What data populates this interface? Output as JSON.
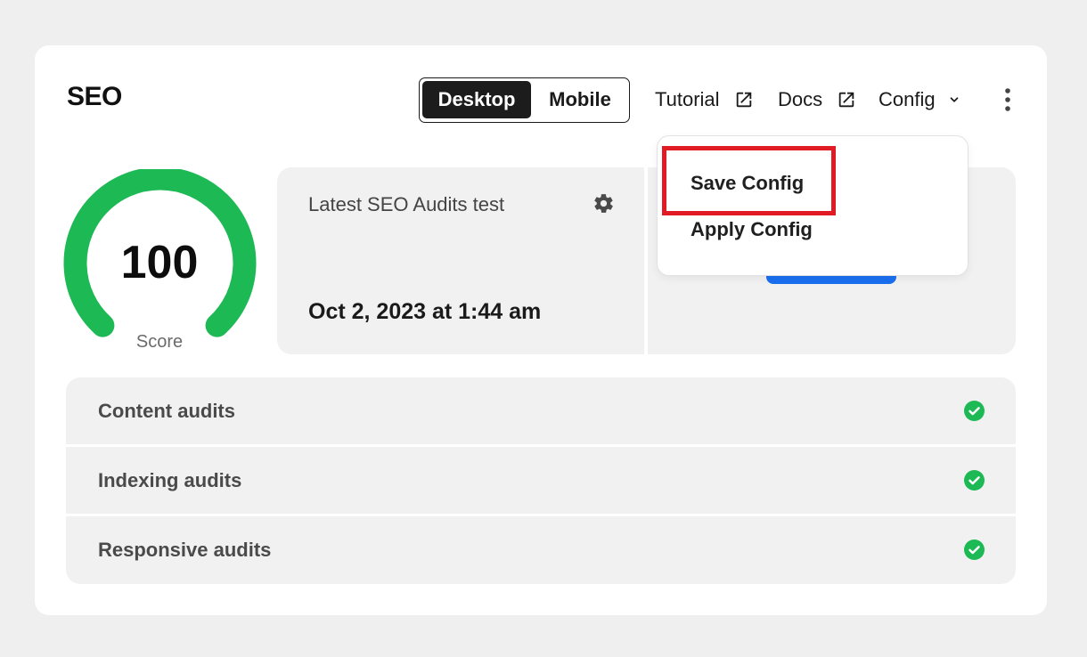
{
  "header": {
    "title": "SEO",
    "device_toggle": {
      "options": [
        "Desktop",
        "Mobile"
      ],
      "selected": "Desktop"
    },
    "links": {
      "tutorial": "Tutorial",
      "docs": "Docs",
      "config": "Config"
    }
  },
  "score": {
    "value": "100",
    "label": "Score",
    "gauge_fraction": 1.0,
    "color": "#1db954"
  },
  "latest_audit": {
    "heading": "Latest SEO Audits test",
    "date": "Oct 2, 2023 at 1:44 am"
  },
  "config_menu": {
    "items": [
      "Save Config",
      "Apply Config"
    ],
    "highlighted": "Save Config",
    "highlight_color": "#e01b24"
  },
  "audits": [
    {
      "label": "Content audits",
      "status": "passed"
    },
    {
      "label": "Indexing audits",
      "status": "passed"
    },
    {
      "label": "Responsive audits",
      "status": "passed"
    }
  ],
  "colors": {
    "accent_blue": "#1a6ff0",
    "success_green": "#1db954"
  }
}
